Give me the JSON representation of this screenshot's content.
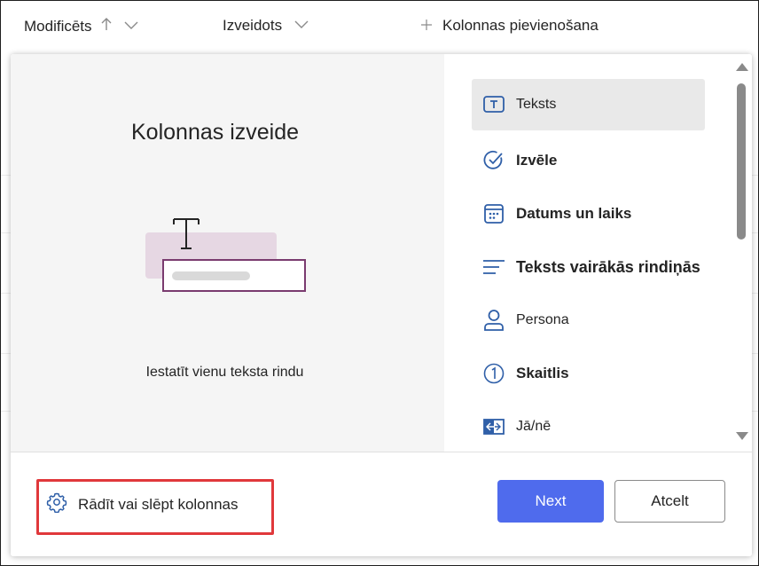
{
  "header": {
    "modified_label": "Modificēts",
    "created_label": "Izveidots",
    "add_column_label": "Kolonnas pievienošana"
  },
  "dialog": {
    "title": "Kolonnas izveide",
    "description": "Iestatīt vienu teksta rindu",
    "column_types": [
      {
        "label": "Teksts",
        "icon": "text-box-icon",
        "selected": true
      },
      {
        "label": "Izvēle",
        "icon": "checkmark-circle-icon",
        "selected": false
      },
      {
        "label": "Datums un laiks",
        "icon": "calendar-icon",
        "selected": false
      },
      {
        "label": "Teksts vairākās rindiņās",
        "icon": "multiline-text-icon",
        "selected": false
      },
      {
        "label": "Persona",
        "icon": "person-icon",
        "selected": false
      },
      {
        "label": "Skaitlis",
        "icon": "number-circle-icon",
        "selected": false
      },
      {
        "label": "Jā/nē",
        "icon": "yes-no-toggle-icon",
        "selected": false
      }
    ],
    "footer": {
      "show_hide_label": "Rādīt vai slēpt kolonnas",
      "next_label": "Next",
      "cancel_label": "Atcelt"
    }
  },
  "colors": {
    "accent": "#4f6bed",
    "icon_blue": "#2f5fa8",
    "highlight_red": "#e0383b",
    "illustration_purple": "#7a3b6f",
    "illustration_bg": "#e6d7e3"
  }
}
